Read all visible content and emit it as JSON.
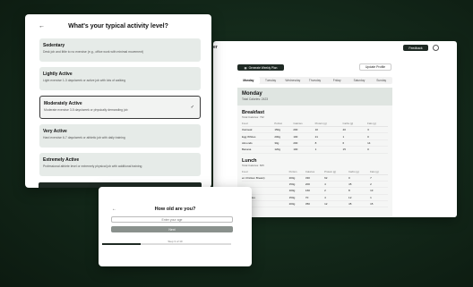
{
  "plan": {
    "brand": "er",
    "feedback_label": "Feedback",
    "generate_label": "Generate Weekly Plan",
    "update_label": "Update Profile",
    "days": [
      "Monday",
      "Tuesday",
      "Wednesday",
      "Thursday",
      "Friday",
      "Saturday",
      "Sunday"
    ],
    "selected_day": "Monday",
    "day_title": "Monday",
    "day_total": "Total Calories: 2423",
    "columns": [
      "Food",
      "Portion",
      "Calories",
      "Protein (g)",
      "Carbs (g)",
      "Fats (g)"
    ],
    "meals": [
      {
        "title": "Breakfast",
        "sub": "Total Calories: 732",
        "rows": [
          [
            "Oatmeal",
            "150g",
            "200",
            "10",
            "40",
            "3"
          ],
          [
            "Egg Whites",
            "200g",
            "100",
            "21",
            "1",
            "0"
          ],
          [
            "Almonds",
            "30g",
            "200",
            "8",
            "6",
            "14"
          ],
          [
            "Banana",
            "120g",
            "100",
            "1",
            "15",
            "0"
          ]
        ]
      },
      {
        "title": "Lunch",
        "sub": "Total Calories: 825",
        "rows": [
          [
            "en Chicken Breast)",
            "200g",
            "330",
            "62",
            "0",
            "7"
          ],
          [
            "",
            "150g",
            "200",
            "4",
            "45",
            "2"
          ],
          [
            "",
            "100g",
            "160",
            "2",
            "8",
            "13"
          ],
          [
            "Vegetables",
            "150g",
            "70",
            "4",
            "12",
            "1"
          ],
          [
            "",
            "200g",
            "350",
            "12",
            "45",
            "15"
          ]
        ]
      }
    ]
  },
  "activity": {
    "title": "What's your typical activity level?",
    "options": [
      {
        "label": "Sedentary",
        "desc": "Desk job and little to no exercise (e.g., office work with minimal movement)",
        "selected": false
      },
      {
        "label": "Lightly Active",
        "desc": "Light exercise 1-3 days/week or active job with lots of walking",
        "selected": false
      },
      {
        "label": "Moderately Active",
        "desc": "Moderate exercise 3-5 days/week or physically demanding job",
        "selected": true
      },
      {
        "label": "Very Active",
        "desc": "Hard exercise 6-7 days/week or athletic job with daily training",
        "selected": false
      },
      {
        "label": "Extremely Active",
        "desc": "Professional athlete level or extremely physical job with additional training",
        "selected": false
      }
    ],
    "check_glyph": "✓"
  },
  "age": {
    "title": "How old are you?",
    "placeholder": "Enter your age",
    "next_label": "Next",
    "step_text": "Step 3 of 10",
    "progress": 0.3
  },
  "icons": {
    "back": "←"
  }
}
